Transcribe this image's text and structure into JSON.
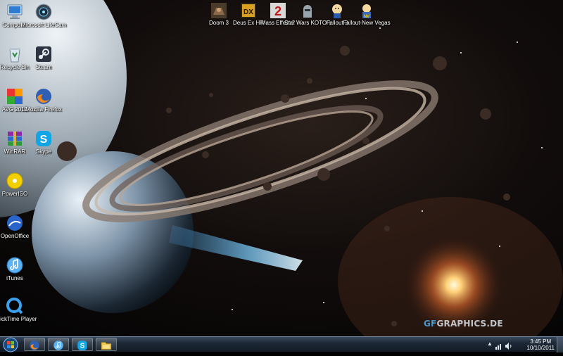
{
  "desktop": {
    "icons_left": [
      {
        "label": "Computer",
        "icon": "computer-icon"
      },
      {
        "label": "Microsoft LifeCam",
        "icon": "lifecam-icon"
      },
      {
        "label": "Recycle Bin",
        "icon": "recycle-bin-icon"
      },
      {
        "label": "Steam",
        "icon": "steam-icon"
      },
      {
        "label": "AVG 2012",
        "icon": "avg-icon"
      },
      {
        "label": "Mozilla Firefox",
        "icon": "firefox-icon"
      },
      {
        "label": "WinRAR",
        "icon": "winrar-icon"
      },
      {
        "label": "Skype",
        "icon": "skype-icon"
      },
      {
        "label": "PowerISO",
        "icon": "poweriso-icon"
      },
      {
        "label": "OpenOffice",
        "icon": "openoffice-icon"
      },
      {
        "label": "iTunes",
        "icon": "itunes-icon"
      },
      {
        "label": "QuickTime Player",
        "icon": "quicktime-icon"
      }
    ],
    "icons_top": [
      {
        "label": "Doom 3",
        "icon": "doom3-icon"
      },
      {
        "label": "Deus Ex HR",
        "icon": "deus-ex-icon"
      },
      {
        "label": "Mass Effect 2",
        "icon": "mass-effect-icon"
      },
      {
        "label": "Star Wars KOTOR",
        "icon": "kotor-icon"
      },
      {
        "label": "Fallout 3",
        "icon": "fallout3-icon"
      },
      {
        "label": "Fallout-New Vegas",
        "icon": "new-vegas-icon"
      }
    ],
    "watermark": {
      "prefix": "GF",
      "rest": "GRAPHICS.DE"
    }
  },
  "taskbar": {
    "pinned": [
      "firefox-icon",
      "itunes-icon",
      "skype-icon",
      "explorer-icon"
    ],
    "clock": {
      "time": "3:45 PM",
      "date": "10/10/2011"
    }
  },
  "colors": {
    "taskbar": "#1c2836",
    "accent": "#4aa3e0"
  }
}
